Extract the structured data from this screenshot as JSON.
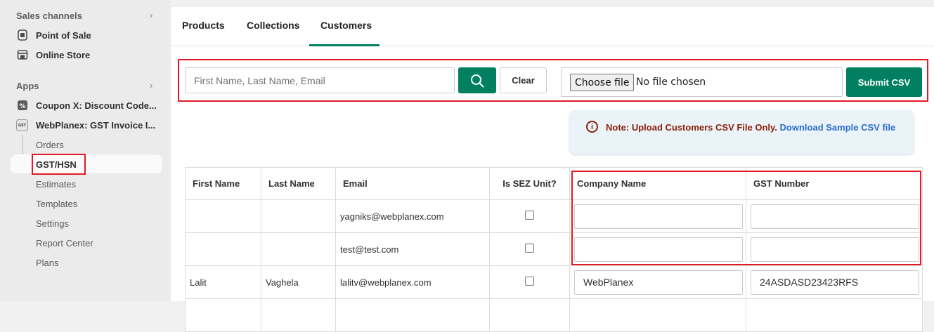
{
  "sidebar": {
    "sales_channels_heading": "Sales channels",
    "sales_channels": [
      {
        "label": "Point of Sale",
        "icon": "pos-icon"
      },
      {
        "label": "Online Store",
        "icon": "store-icon"
      }
    ],
    "apps_heading": "Apps",
    "apps": [
      {
        "label": "Coupon X: Discount Code...",
        "icon": "coupon-icon"
      },
      {
        "label": "WebPlanex: GST Invoice I...",
        "icon": "gst-icon"
      }
    ],
    "gst_icon_text": "GST",
    "subitems": [
      "Orders",
      "GST/HSN",
      "Estimates",
      "Templates",
      "Settings",
      "Report Center",
      "Plans"
    ]
  },
  "tabs": [
    "Products",
    "Collections",
    "Customers"
  ],
  "active_tab": "Customers",
  "search": {
    "placeholder": "First Name, Last Name, Email",
    "value": ""
  },
  "clear_label": "Clear",
  "file": {
    "choose_label": "Choose file",
    "status": "No file chosen"
  },
  "submit_label": "Submit CSV",
  "note": {
    "text": "Note: Upload Customers CSV File Only.",
    "link": "Download Sample CSV file"
  },
  "table": {
    "headers": [
      "First Name",
      "Last Name",
      "Email",
      "Is SEZ Unit?",
      "Company Name",
      "GST Number"
    ],
    "rows": [
      {
        "first": "",
        "last": "",
        "email": "yagniks@webplanex.com",
        "sez": false,
        "company": "",
        "gst": ""
      },
      {
        "first": "",
        "last": "",
        "email": "test@test.com",
        "sez": false,
        "company": "",
        "gst": ""
      },
      {
        "first": "Lalit",
        "last": "Vaghela",
        "email": "lalitv@webplanex.com",
        "sez": false,
        "company": "WebPlanex",
        "gst": "24ASDASD23423RFS"
      }
    ]
  },
  "colors": {
    "accent": "#008060",
    "highlight": "#e01b24",
    "note_text": "#8e1f0b",
    "link": "#2c6ecb"
  }
}
